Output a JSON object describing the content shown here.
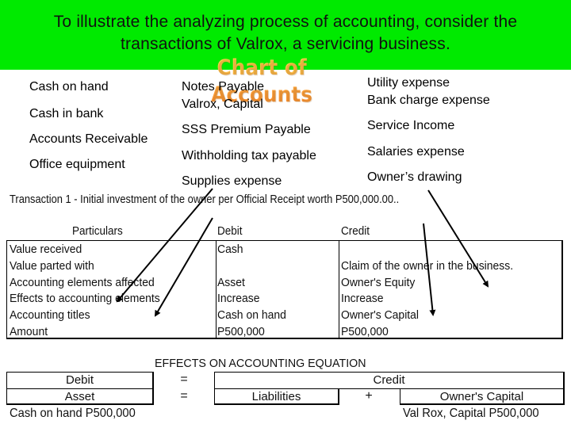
{
  "banner": {
    "title_line1": "To illustrate the analyzing process of accounting, consider the",
    "title_line2": "transactions of Valrox, a servicing business.",
    "background_color": "#00ea00"
  },
  "chart_of_accounts": {
    "heading": "Chart of Accounts",
    "column1": [
      "Cash on hand",
      "Cash in bank",
      "Accounts Receivable",
      "Office equipment"
    ],
    "column2": [
      "Notes Payable",
      "Valrox, Capital",
      "SSS Premium Payable",
      "Withholding tax payable",
      "Supplies expense"
    ],
    "column3": [
      "Utility expense",
      "Bank charge expense",
      "Service Income",
      "Salaries expense",
      "Owner’s drawing"
    ]
  },
  "transaction": {
    "description": "Transaction 1 - Initial investment of the owner per Official Receipt worth P500,000.00..",
    "headers": {
      "particulars": "Particulars",
      "debit": "Debit",
      "credit": "Credit"
    },
    "rows": [
      {
        "particular": "Value received",
        "debit": "Cash",
        "credit": ""
      },
      {
        "particular": "Value parted with",
        "debit": "",
        "credit": "Claim of the owner in the business."
      },
      {
        "particular": "Accounting elements affected",
        "debit": "Asset",
        "credit": "Owner's Equity"
      },
      {
        "particular": "Effects to accounting elements",
        "debit": "Increase",
        "credit": "Increase"
      },
      {
        "particular": "Accounting titles",
        "debit": "Cash on hand",
        "credit": "Owner's Capital"
      },
      {
        "particular": "Amount",
        "debit": "P500,000",
        "credit": "P500,000"
      }
    ]
  },
  "equation": {
    "title": "EFFECTS ON ACCOUNTING EQUATION",
    "debit_label": "Debit",
    "asset_label": "Asset",
    "equals1": "=",
    "equals2": "=",
    "credit_label": "Credit",
    "liabilities_label": "Liabilities",
    "plus": "+",
    "owners_capital_label": "Owner's Capital",
    "debit_note": "Cash on hand  P500,000",
    "credit_note": "Val Rox, Capital  P500,000"
  }
}
